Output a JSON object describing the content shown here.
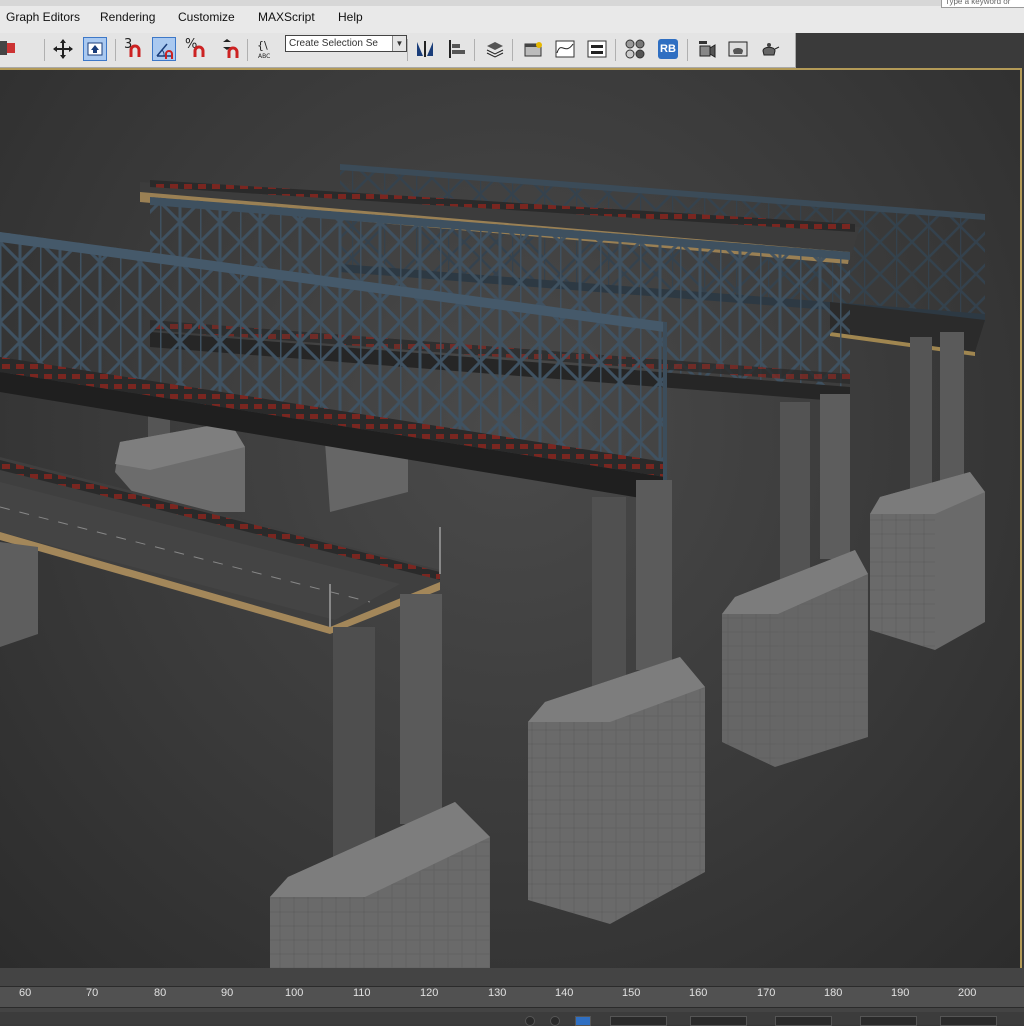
{
  "menu": {
    "items": [
      "Graph Editors",
      "Rendering",
      "Customize",
      "MAXScript",
      "Help"
    ]
  },
  "search": {
    "placeholder": "Type a keyword or phrase"
  },
  "toolbar": {
    "selection_set_value": "Create Selection Se",
    "rb_label": "RB",
    "snap_label": "3",
    "percent_label": "%"
  },
  "timeline": {
    "ticks": [
      60,
      70,
      80,
      90,
      100,
      110,
      120,
      130,
      140,
      150,
      160,
      170,
      180,
      190,
      200
    ]
  },
  "colors": {
    "viewport_border": "#b39a57",
    "truss": "#3d4f5e",
    "pier": "#6b6b6b",
    "deck": "#4a4a4a",
    "rail_accent": "#8c2a24",
    "active_button": "#aac9f0"
  }
}
